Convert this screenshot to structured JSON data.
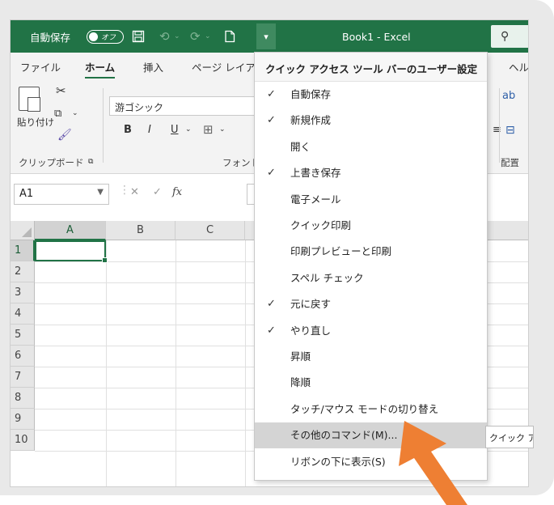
{
  "title_bar": {
    "autosave_label": "自動保存",
    "autosave_toggle": "オフ",
    "doc_title": "Book1  -  Excel",
    "dropdown_glyph": "▾"
  },
  "tabs": [
    "ファイル",
    "ホーム",
    "挿入",
    "ページ レイア",
    "ヘル"
  ],
  "ribbon": {
    "paste_label": "貼り付け",
    "clipboard_label": "クリップボード",
    "font_name": "游ゴシック",
    "font_group_label": "フォント",
    "align_group_label": "配置",
    "bold": "B",
    "italic": "I",
    "underline": "U"
  },
  "formula_bar": {
    "name_box": "A1",
    "fx": "fx"
  },
  "grid": {
    "columns": [
      "A",
      "B",
      "C"
    ],
    "rows": [
      "1",
      "2",
      "3",
      "4",
      "5",
      "6",
      "7",
      "8",
      "9",
      "10"
    ],
    "active_cell": "A1"
  },
  "menu": {
    "title": "クイック アクセス ツール バーのユーザー設定",
    "items": [
      {
        "label": "自動保存",
        "checked": true
      },
      {
        "label": "新規作成",
        "checked": true
      },
      {
        "label": "開く",
        "checked": false
      },
      {
        "label": "上書き保存",
        "checked": true
      },
      {
        "label": "電子メール",
        "checked": false
      },
      {
        "label": "クイック印刷",
        "checked": false
      },
      {
        "label": "印刷プレビューと印刷",
        "checked": false
      },
      {
        "label": "スペル チェック",
        "checked": false
      },
      {
        "label": "元に戻す",
        "checked": true
      },
      {
        "label": "やり直し",
        "checked": true
      },
      {
        "label": "昇順",
        "checked": false
      },
      {
        "label": "降順",
        "checked": false
      },
      {
        "label": "タッチ/マウス モードの切り替え",
        "checked": false
      },
      {
        "label": "その他のコマンド(M)...",
        "checked": false,
        "highlighted": true
      },
      {
        "label": "リボンの下に表示(S)",
        "checked": false
      }
    ],
    "check_glyph": "✓"
  },
  "tooltip": "クイック ア",
  "colors": {
    "excel_green": "#217346",
    "arrow": "#ee7f33"
  }
}
